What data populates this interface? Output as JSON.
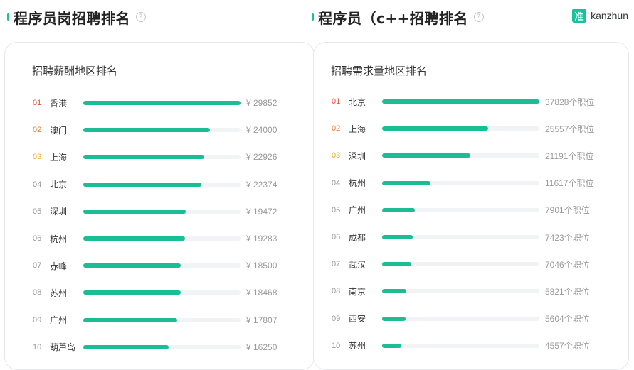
{
  "header": {
    "left_title": "程序员岗招聘排名",
    "right_title": "程序员（c++招聘排名",
    "help_glyph": "?",
    "brand_logo": "准",
    "brand_name": "kanzhun",
    "accent_color": "#18c29c"
  },
  "salary_card": {
    "title": "招聘薪酬地区排名",
    "rows": [
      {
        "rank": "01",
        "city": "香港",
        "value": "¥ 29852",
        "amount": 29852
      },
      {
        "rank": "02",
        "city": "澳门",
        "value": "¥ 24000",
        "amount": 24000
      },
      {
        "rank": "03",
        "city": "上海",
        "value": "¥ 22926",
        "amount": 22926
      },
      {
        "rank": "04",
        "city": "北京",
        "value": "¥ 22374",
        "amount": 22374
      },
      {
        "rank": "05",
        "city": "深圳",
        "value": "¥ 19472",
        "amount": 19472
      },
      {
        "rank": "06",
        "city": "杭州",
        "value": "¥ 19283",
        "amount": 19283
      },
      {
        "rank": "07",
        "city": "赤峰",
        "value": "¥ 18500",
        "amount": 18500
      },
      {
        "rank": "08",
        "city": "苏州",
        "value": "¥ 18468",
        "amount": 18468
      },
      {
        "rank": "09",
        "city": "广州",
        "value": "¥ 17807",
        "amount": 17807
      },
      {
        "rank": "10",
        "city": "葫芦岛",
        "value": "¥ 16250",
        "amount": 16250
      }
    ]
  },
  "demand_card": {
    "title": "招聘需求量地区排名",
    "rows": [
      {
        "rank": "01",
        "city": "北京",
        "value": "37828个职位",
        "amount": 37828
      },
      {
        "rank": "02",
        "city": "上海",
        "value": "25557个职位",
        "amount": 25557
      },
      {
        "rank": "03",
        "city": "深圳",
        "value": "21191个职位",
        "amount": 21191
      },
      {
        "rank": "04",
        "city": "杭州",
        "value": "11617个职位",
        "amount": 11617
      },
      {
        "rank": "05",
        "city": "广州",
        "value": "7901个职位",
        "amount": 7901
      },
      {
        "rank": "06",
        "city": "成都",
        "value": "7423个职位",
        "amount": 7423
      },
      {
        "rank": "07",
        "city": "武汉",
        "value": "7046个职位",
        "amount": 7046
      },
      {
        "rank": "08",
        "city": "南京",
        "value": "5821个职位",
        "amount": 5821
      },
      {
        "rank": "09",
        "city": "西安",
        "value": "5604个职位",
        "amount": 5604
      },
      {
        "rank": "10",
        "city": "苏州",
        "value": "4557个职位",
        "amount": 4557
      }
    ]
  }
}
